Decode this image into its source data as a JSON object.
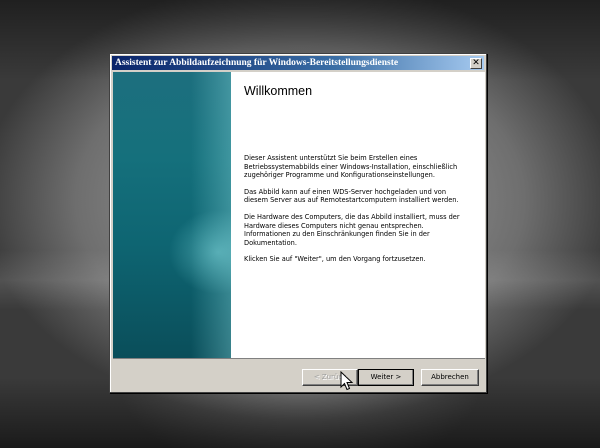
{
  "window": {
    "title": "Assistent zur Abbildaufzeichnung für Windows-Bereitstellungsdienste",
    "close_glyph": "✕"
  },
  "page": {
    "heading": "Willkommen",
    "paragraphs": [
      "Dieser Assistent unterstützt Sie beim Erstellen eines Betriebssystemabbilds einer Windows-Installation, einschließlich zugehöriger Programme und Konfigurationseinstellungen.",
      "Das Abbild kann auf einen WDS-Server hochgeladen und von diesem Server aus auf Remotestartcomputern installiert werden.",
      "Die Hardware des Computers, die das Abbild installiert, muss der Hardware dieses Computers nicht genau entsprechen. Informationen zu den Einschränkungen finden Sie in der Dokumentation.",
      "Klicken Sie auf \"Weiter\", um den Vorgang fortzusetzen."
    ]
  },
  "buttons": {
    "back": "< Zurück",
    "next": "Weiter >",
    "cancel": "Abbrechen"
  },
  "icons": {
    "close": "close-icon",
    "cursor": "mouse-pointer-icon"
  }
}
